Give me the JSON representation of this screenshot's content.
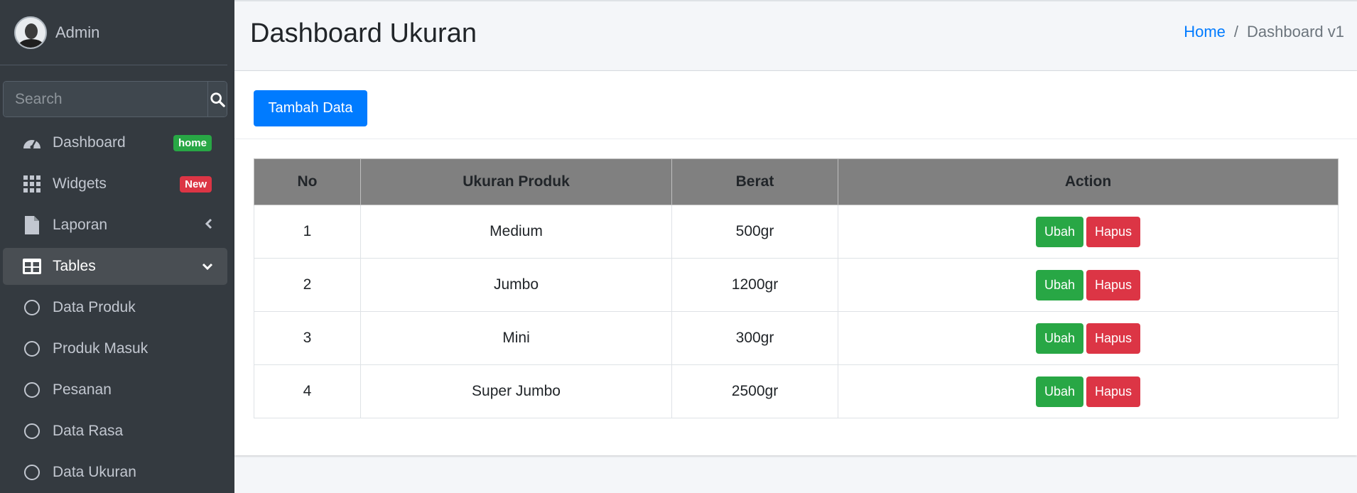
{
  "sidebar": {
    "user_name": "Admin",
    "search_placeholder": "Search",
    "items": [
      {
        "label": "Dashboard",
        "badge": "home"
      },
      {
        "label": "Widgets",
        "badge": "New"
      },
      {
        "label": "Laporan"
      },
      {
        "label": "Tables"
      },
      {
        "label": "Data Produk"
      },
      {
        "label": "Produk Masuk"
      },
      {
        "label": "Pesanan"
      },
      {
        "label": "Data Rasa"
      },
      {
        "label": "Data Ukuran"
      }
    ]
  },
  "header": {
    "title": "Dashboard Ukuran",
    "breadcrumb": [
      "Home",
      "Dashboard v1"
    ]
  },
  "card": {
    "add_button": "Tambah Data"
  },
  "table": {
    "columns": [
      "No",
      "Ukuran Produk",
      "Berat",
      "Action"
    ],
    "rows": [
      {
        "no": "1",
        "ukuran": "Medium",
        "berat": "500gr"
      },
      {
        "no": "2",
        "ukuran": "Jumbo",
        "berat": "1200gr"
      },
      {
        "no": "3",
        "ukuran": "Mini",
        "berat": "300gr"
      },
      {
        "no": "4",
        "ukuran": "Super Jumbo",
        "berat": "2500gr"
      }
    ],
    "edit_label": "Ubah",
    "delete_label": "Hapus"
  },
  "colors": {
    "sidebar_bg": "#343a40",
    "primary": "#007bff",
    "success": "#28a745",
    "danger": "#dc3545",
    "table_header_bg": "#808080"
  }
}
